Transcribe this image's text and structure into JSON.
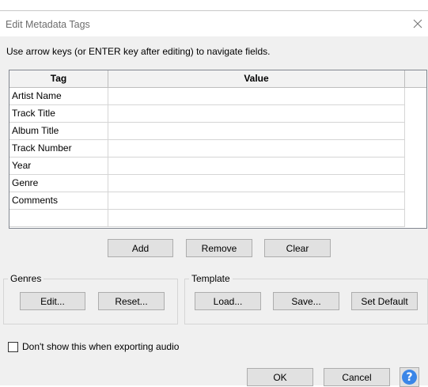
{
  "window": {
    "title": "Edit Metadata Tags"
  },
  "instructions": "Use arrow keys (or ENTER key after editing) to navigate fields.",
  "grid": {
    "headers": {
      "tag": "Tag",
      "value": "Value"
    },
    "rows": [
      {
        "tag": "Artist Name",
        "value": ""
      },
      {
        "tag": "Track Title",
        "value": ""
      },
      {
        "tag": "Album Title",
        "value": ""
      },
      {
        "tag": "Track Number",
        "value": ""
      },
      {
        "tag": "Year",
        "value": ""
      },
      {
        "tag": "Genre",
        "value": ""
      },
      {
        "tag": "Comments",
        "value": ""
      },
      {
        "tag": "",
        "value": ""
      }
    ]
  },
  "grid_buttons": {
    "add": "Add",
    "remove": "Remove",
    "clear": "Clear"
  },
  "genres": {
    "label": "Genres",
    "edit": "Edit...",
    "reset": "Reset..."
  },
  "template": {
    "label": "Template",
    "load": "Load...",
    "save": "Save...",
    "set_default": "Set Default"
  },
  "checkbox": {
    "label": "Don't show this when exporting audio",
    "checked": false
  },
  "footer": {
    "ok": "OK",
    "cancel": "Cancel",
    "help_glyph": "?"
  },
  "colors": {
    "help_accent": "#3a86e8",
    "dialog_bg": "#f0f0f0"
  }
}
